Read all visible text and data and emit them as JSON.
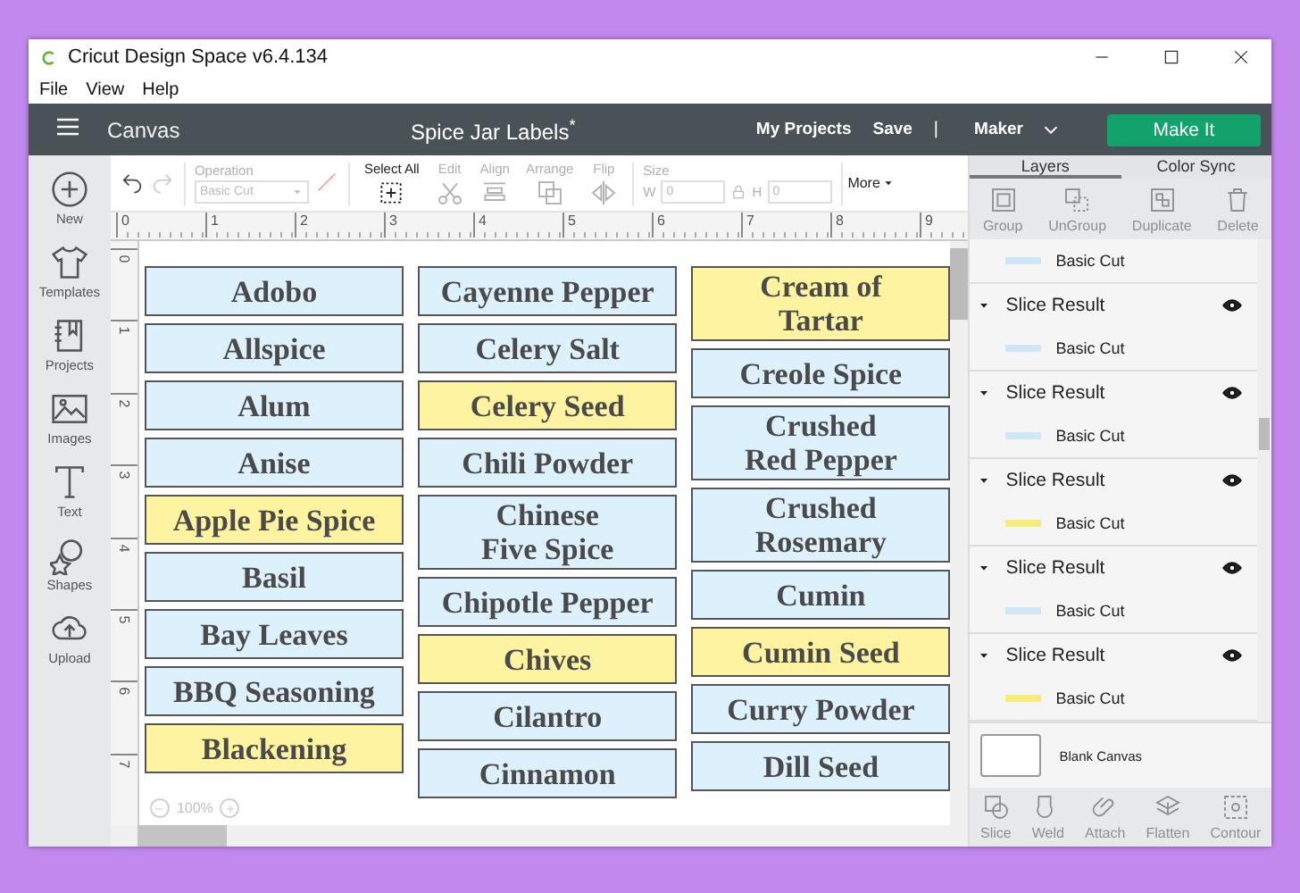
{
  "window": {
    "title": "Cricut Design Space  v6.4.134"
  },
  "menu": [
    "File",
    "View",
    "Help"
  ],
  "header": {
    "menu_label": "Canvas",
    "project_title": "Spice Jar Labels",
    "unsaved_mark": "*",
    "links": [
      "My Projects",
      "Save"
    ],
    "separator": "|",
    "machine": "Maker",
    "primary_button": "Make It"
  },
  "sidebar": [
    {
      "label": "New",
      "kind": "new"
    },
    {
      "label": "Templates",
      "kind": "templates"
    },
    {
      "label": "Projects",
      "kind": "projects"
    },
    {
      "label": "Images",
      "kind": "images"
    },
    {
      "label": "Text",
      "kind": "text"
    },
    {
      "label": "Shapes",
      "kind": "shapes"
    },
    {
      "label": "Upload",
      "kind": "upload"
    }
  ],
  "toolbar": {
    "undo": {
      "disabled": false
    },
    "redo": {
      "disabled": true
    },
    "operation": {
      "label": "Operation",
      "value": "Basic Cut",
      "disabled": true
    },
    "tools": [
      {
        "label": "Select All",
        "kind": "select",
        "disabled": false
      },
      {
        "label": "Edit",
        "kind": "edit",
        "disabled": true
      },
      {
        "label": "Align",
        "kind": "align",
        "disabled": true
      },
      {
        "label": "Arrange",
        "kind": "arrange",
        "disabled": true
      },
      {
        "label": "Flip",
        "kind": "flip",
        "disabled": true
      }
    ],
    "size": {
      "label": "Size",
      "w_label": "W",
      "w_value": "0",
      "h_label": "H",
      "h_value": "0",
      "disabled": true
    },
    "more": "More"
  },
  "ruler": {
    "x_ticks": [
      "0",
      "1",
      "2",
      "3",
      "4",
      "5",
      "6",
      "7",
      "8",
      "9"
    ],
    "y_ticks": [
      "0",
      "1",
      "2",
      "3",
      "4",
      "5",
      "6",
      "7"
    ]
  },
  "label_columns": [
    [
      {
        "text": "Adobo",
        "color": "#ddf1fc"
      },
      {
        "text": "Allspice",
        "color": "#ddf1fc"
      },
      {
        "text": "Alum",
        "color": "#ddf1fc"
      },
      {
        "text": "Anise",
        "color": "#ddf1fc"
      },
      {
        "text": "Apple Pie Spice",
        "color": "#fdf3a0"
      },
      {
        "text": "Basil",
        "color": "#ddf1fc"
      },
      {
        "text": "Bay Leaves",
        "color": "#ddf1fc"
      },
      {
        "text": "BBQ Seasoning",
        "color": "#ddf1fc"
      },
      {
        "text": "Blackening",
        "color": "#fdf3a0"
      }
    ],
    [
      {
        "text": "Cayenne Pepper",
        "color": "#ddf1fc"
      },
      {
        "text": "Celery Salt",
        "color": "#ddf1fc"
      },
      {
        "text": "Celery Seed",
        "color": "#fdf3a0"
      },
      {
        "text": "Chili Powder",
        "color": "#ddf1fc"
      },
      {
        "text": "Chinese\nFive Spice",
        "color": "#ddf1fc"
      },
      {
        "text": "Chipotle Pepper",
        "color": "#ddf1fc"
      },
      {
        "text": "Chives",
        "color": "#fdf3a0"
      },
      {
        "text": "Cilantro",
        "color": "#ddf1fc"
      },
      {
        "text": "Cinnamon",
        "color": "#ddf1fc"
      }
    ],
    [
      {
        "text": "Cream of\nTartar",
        "color": "#fdf3a0"
      },
      {
        "text": "Creole Spice",
        "color": "#ddf1fc"
      },
      {
        "text": "Crushed\nRed Pepper",
        "color": "#ddf1fc"
      },
      {
        "text": "Crushed\nRosemary",
        "color": "#ddf1fc"
      },
      {
        "text": "Cumin",
        "color": "#ddf1fc"
      },
      {
        "text": "Cumin Seed",
        "color": "#fdf3a0"
      },
      {
        "text": "Curry Powder",
        "color": "#ddf1fc"
      },
      {
        "text": "Dill Seed",
        "color": "#ddf1fc"
      }
    ]
  ],
  "zoom": {
    "value": "100%"
  },
  "panel": {
    "tabs": [
      {
        "label": "Layers",
        "selected": true
      },
      {
        "label": "Color Sync",
        "selected": false
      }
    ],
    "actions": [
      {
        "label": "Group",
        "kind": "group",
        "disabled": true
      },
      {
        "label": "UnGroup",
        "kind": "ungroup",
        "disabled": true
      },
      {
        "label": "Duplicate",
        "kind": "duplicate",
        "disabled": true
      },
      {
        "label": "Delete",
        "kind": "delete",
        "disabled": true
      }
    ],
    "layers": [
      {
        "kind": "item",
        "label": "Basic Cut",
        "color": "#cfe6f5"
      },
      {
        "kind": "group",
        "label": "Slice Result",
        "expanded": true,
        "visible": true,
        "children": [
          {
            "label": "Basic Cut",
            "color": "#cfe6f5"
          }
        ]
      },
      {
        "kind": "group",
        "label": "Slice Result",
        "expanded": true,
        "visible": true,
        "children": [
          {
            "label": "Basic Cut",
            "color": "#cfe6f5"
          }
        ]
      },
      {
        "kind": "group",
        "label": "Slice Result",
        "expanded": true,
        "visible": true,
        "children": [
          {
            "label": "Basic Cut",
            "color": "#f5ec7a"
          }
        ]
      },
      {
        "kind": "group",
        "label": "Slice Result",
        "expanded": true,
        "visible": true,
        "children": [
          {
            "label": "Basic Cut",
            "color": "#cfe6f5"
          }
        ]
      },
      {
        "kind": "group",
        "label": "Slice Result",
        "expanded": true,
        "visible": true,
        "children": [
          {
            "label": "Basic Cut",
            "color": "#f5ec7a"
          }
        ]
      }
    ],
    "canvas_label": "Blank Canvas",
    "bottom_actions": [
      {
        "label": "Slice",
        "kind": "slice",
        "disabled": true
      },
      {
        "label": "Weld",
        "kind": "weld",
        "disabled": true
      },
      {
        "label": "Attach",
        "kind": "attach",
        "disabled": true
      },
      {
        "label": "Flatten",
        "kind": "flatten",
        "disabled": true
      },
      {
        "label": "Contour",
        "kind": "contour",
        "disabled": true
      }
    ]
  }
}
